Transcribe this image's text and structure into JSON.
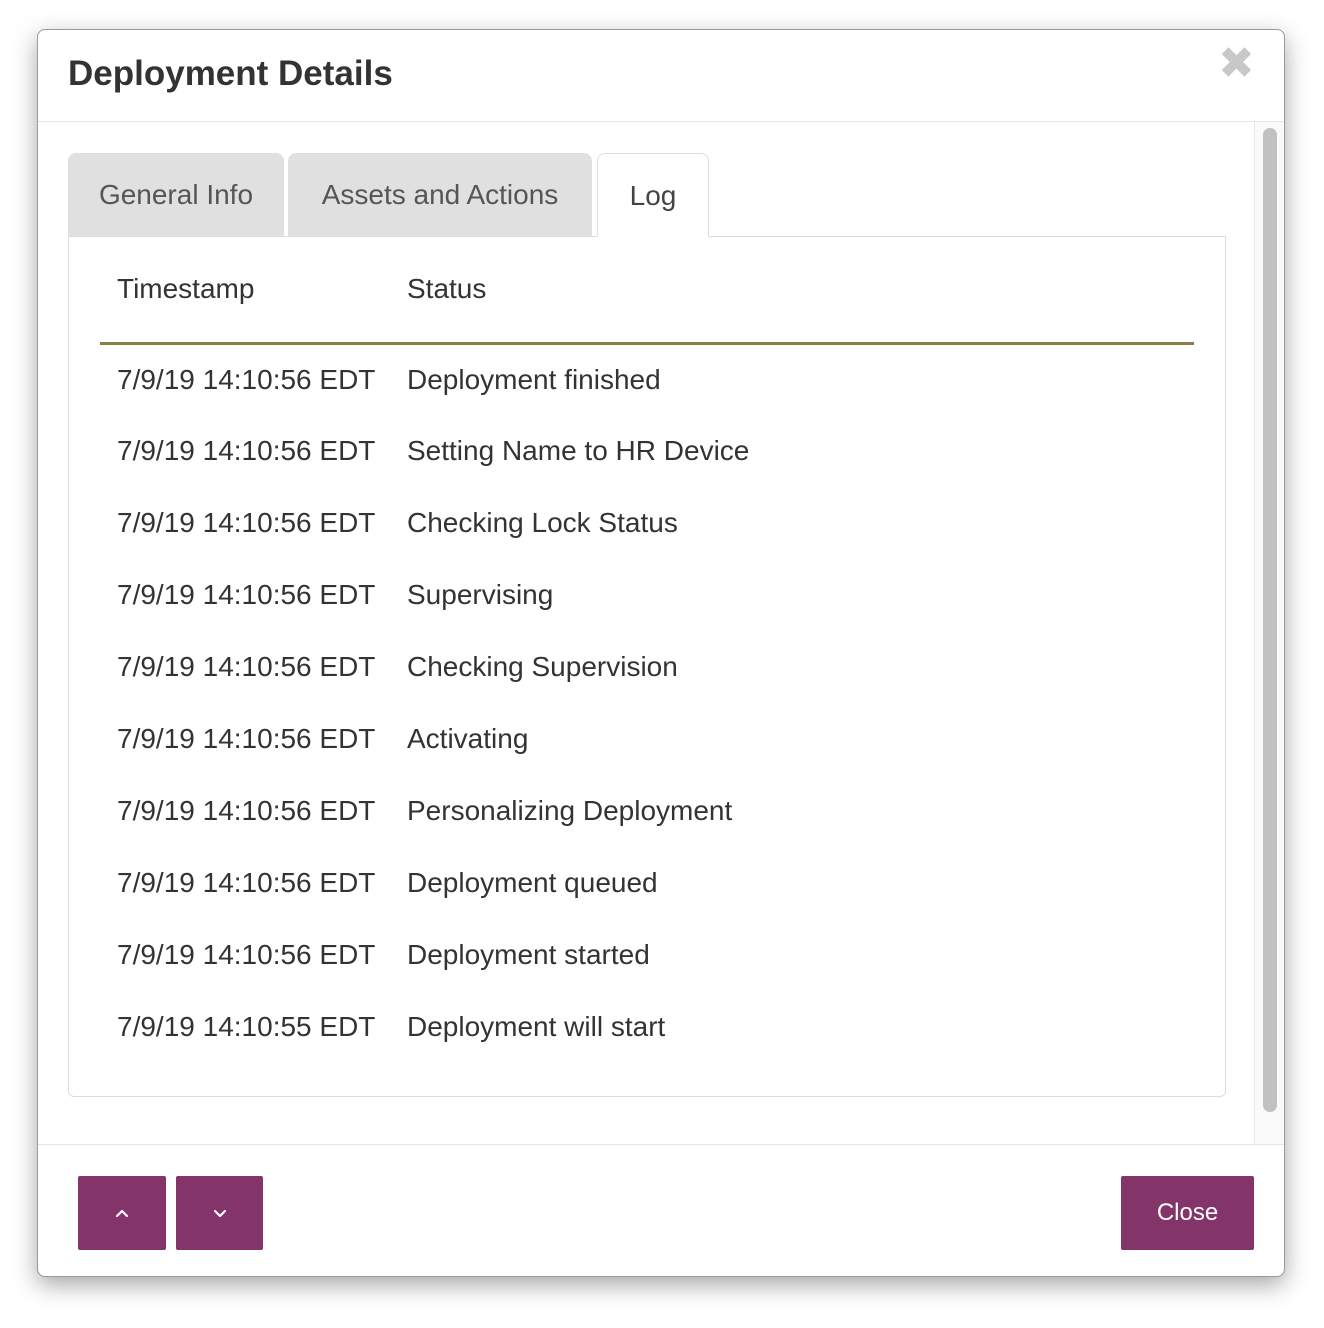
{
  "dialog": {
    "title": "Deployment Details",
    "close_glyph": "✖"
  },
  "tabs": [
    {
      "label": "General Info",
      "active": false
    },
    {
      "label": "Assets and Actions",
      "active": false
    },
    {
      "label": "Log",
      "active": true
    }
  ],
  "log": {
    "columns": [
      "Timestamp",
      "Status"
    ],
    "rows": [
      {
        "timestamp": "7/9/19 14:10:56 EDT",
        "status": "Deployment finished"
      },
      {
        "timestamp": "7/9/19 14:10:56 EDT",
        "status": "Setting Name to HR Device"
      },
      {
        "timestamp": "7/9/19 14:10:56 EDT",
        "status": "Checking Lock Status"
      },
      {
        "timestamp": "7/9/19 14:10:56 EDT",
        "status": "Supervising"
      },
      {
        "timestamp": "7/9/19 14:10:56 EDT",
        "status": "Checking Supervision"
      },
      {
        "timestamp": "7/9/19 14:10:56 EDT",
        "status": "Activating"
      },
      {
        "timestamp": "7/9/19 14:10:56 EDT",
        "status": "Personalizing Deployment"
      },
      {
        "timestamp": "7/9/19 14:10:56 EDT",
        "status": "Deployment queued"
      },
      {
        "timestamp": "7/9/19 14:10:56 EDT",
        "status": "Deployment started"
      },
      {
        "timestamp": "7/9/19 14:10:55 EDT",
        "status": "Deployment will start"
      }
    ]
  },
  "footer": {
    "up_icon": "chevron-up-icon",
    "down_icon": "chevron-down-icon",
    "close_label": "Close"
  },
  "colors": {
    "button_bg": "#833468",
    "header_rule": "#8a7d45",
    "tab_inactive_bg": "#e0e0e0"
  }
}
